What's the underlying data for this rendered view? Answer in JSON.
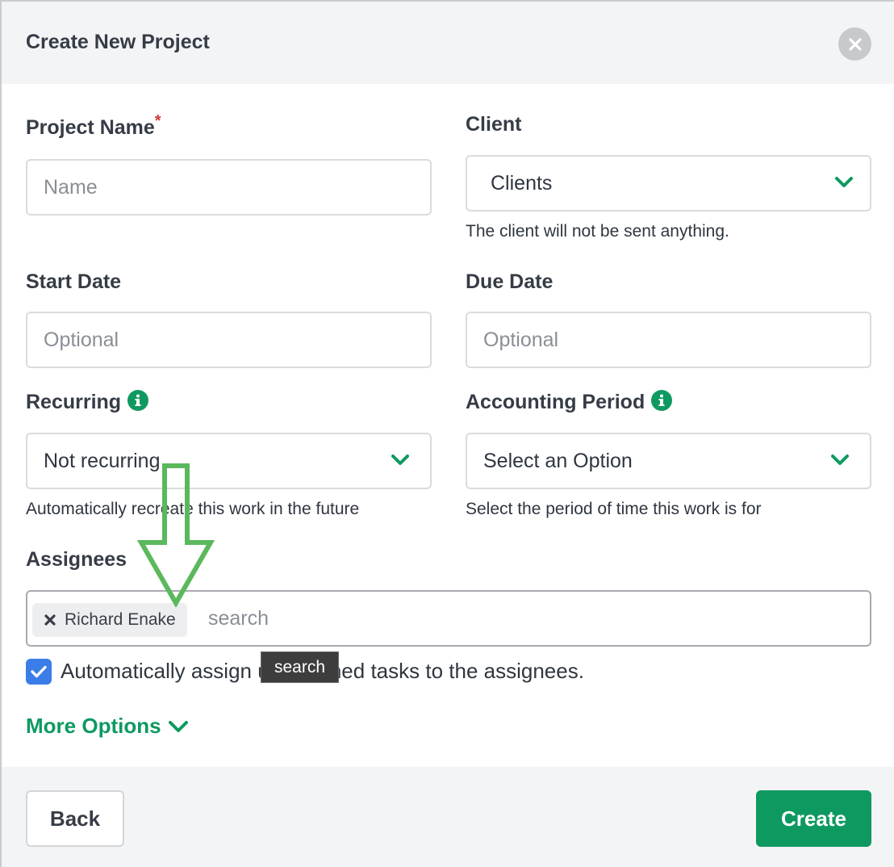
{
  "modal": {
    "title": "Create New Project",
    "close_icon": "close-icon"
  },
  "fields": {
    "project_name": {
      "label": "Project Name",
      "required_marker": "*",
      "placeholder": "Name",
      "value": ""
    },
    "client": {
      "label": "Client",
      "value": "Clients",
      "help": "The client will not be sent anything."
    },
    "start_date": {
      "label": "Start Date",
      "placeholder": "Optional",
      "value": ""
    },
    "due_date": {
      "label": "Due Date",
      "placeholder": "Optional",
      "value": ""
    },
    "recurring": {
      "label": "Recurring",
      "value": "Not recurring",
      "help": "Automatically recreate this work in the future"
    },
    "accounting_period": {
      "label": "Accounting Period",
      "value": "Select an Option",
      "help": "Select the period of time this work is for"
    }
  },
  "assignees": {
    "label": "Assignees",
    "chips": [
      {
        "name": "Richard Enake"
      }
    ],
    "search_placeholder": "search",
    "tooltip": "search",
    "auto_assign_label": "Automatically assign unassigned tasks to the assignees.",
    "auto_assign_checked": true
  },
  "more_options": {
    "label": "More Options"
  },
  "footer": {
    "back_label": "Back",
    "create_label": "Create"
  },
  "colors": {
    "accent_green": "#0e9960",
    "checkbox_blue": "#3b7de6",
    "required_red": "#d0393a",
    "annotation_arrow": "#5cb85c"
  }
}
